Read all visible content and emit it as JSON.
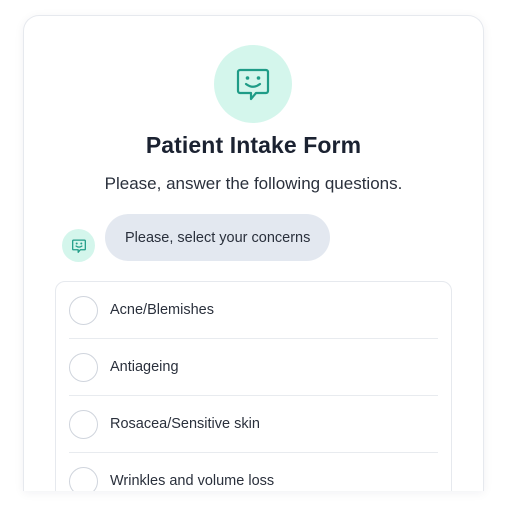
{
  "form": {
    "title": "Patient Intake Form",
    "subtitle": "Please, answer the following questions.",
    "prompt": "Please, select your concerns",
    "avatar_icon": "smiley-chat-icon",
    "accent_color": "#d4f6ec",
    "icon_color": "#1f9c87"
  },
  "options": [
    {
      "label": "Acne/Blemishes",
      "selected": false
    },
    {
      "label": "Antiageing",
      "selected": false
    },
    {
      "label": "Rosacea/Sensitive skin",
      "selected": false
    },
    {
      "label": "Wrinkles and volume loss",
      "selected": false
    }
  ]
}
